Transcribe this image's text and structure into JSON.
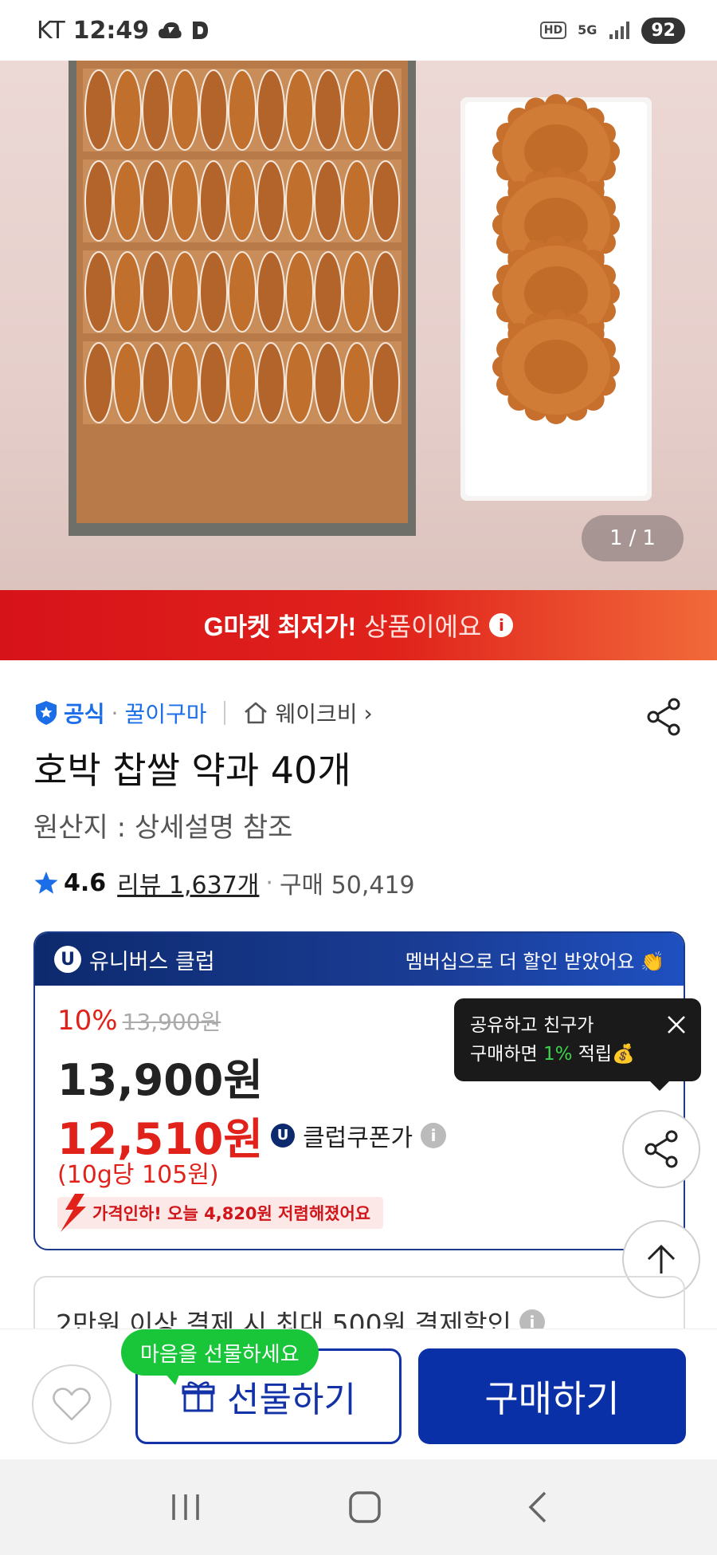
{
  "status_bar": {
    "carrier": "KT",
    "time": "12:49",
    "hd": "HD",
    "network": "5G",
    "battery": "92"
  },
  "hero": {
    "page_current": "1",
    "page_sep": "/",
    "page_total": "1"
  },
  "promo": {
    "strong": "G마켓 최저가!",
    "light": "상품이에요",
    "info": "i"
  },
  "seller": {
    "official_label": "공식",
    "separator": "·",
    "seller_name": "꿀이구마",
    "brand_name": "웨이크비",
    "brand_chevron": "›"
  },
  "product": {
    "title": "호박 찹쌀 약과 40개",
    "origin": "원산지 : 상세설명 참조",
    "rating": "4.6",
    "reviews": "리뷰 1,637개",
    "separator": "·",
    "purchases": "구매 50,419"
  },
  "membership": {
    "badge": "U",
    "club_name": "유니버스 클럽",
    "message": "멤버십으로 더 할인 받았어요 👏",
    "discount_rate": "10%",
    "original_price": "13,900원",
    "sale_price": "13,900원",
    "coupon_price": "12,510원",
    "coupon_label": "클럽쿠폰가",
    "info": "i",
    "unit_price": "(10g당 105원)",
    "price_drop": "가격인하! 오늘 4,820원 저렴해졌어요"
  },
  "tooltip": {
    "line1": "공유하고 친구가",
    "line2_prefix": "구매하면 ",
    "line2_highlight": "1%",
    "line2_suffix": " 적립💰"
  },
  "payment": {
    "text": "2만원 이상 결제 시 최대 500원 결제할인",
    "info": "i"
  },
  "actions": {
    "gift_tip": "마음을 선물하세요",
    "gift_label": "선물하기",
    "buy_label": "구매하기"
  },
  "colors": {
    "accent_red": "#e0221b",
    "brand_blue": "#0a30a8",
    "club_navy": "#0d2a6e",
    "official_blue": "#1b6ee8",
    "gift_tip_green": "#19c63a"
  }
}
